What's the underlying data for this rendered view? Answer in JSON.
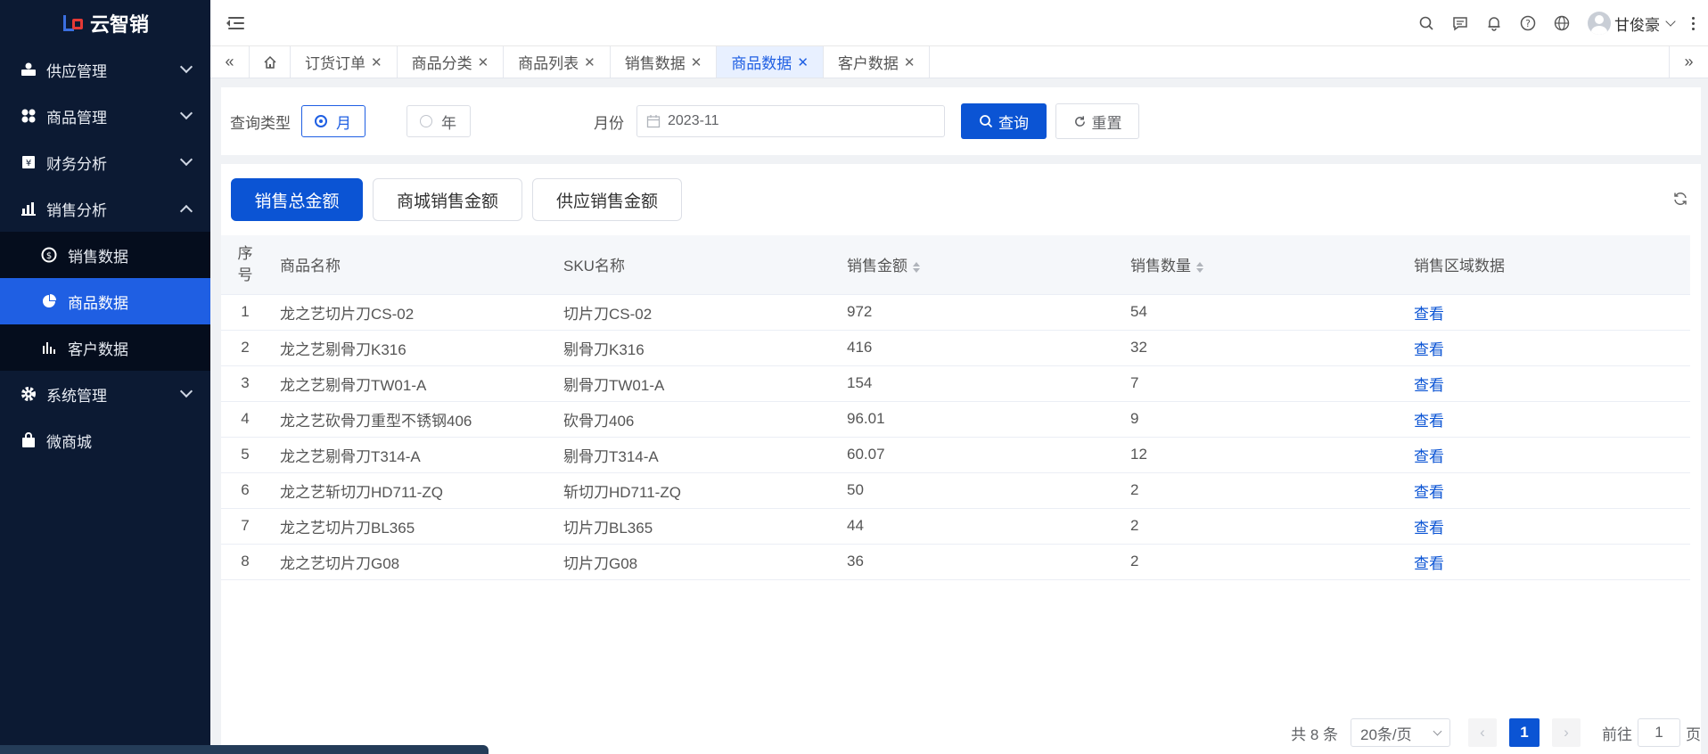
{
  "app": {
    "logo_text": "云智销"
  },
  "sidebar": {
    "items": [
      {
        "label": "供应管理",
        "icon": "supply-icon",
        "expanded": false
      },
      {
        "label": "商品管理",
        "icon": "goods-icon",
        "expanded": false
      },
      {
        "label": "财务分析",
        "icon": "finance-icon",
        "expanded": false
      },
      {
        "label": "销售分析",
        "icon": "sales-chart-icon",
        "expanded": true
      },
      {
        "label": "系统管理",
        "icon": "gear-icon",
        "expanded": false
      },
      {
        "label": "微商城",
        "icon": "shop-bag-icon"
      }
    ],
    "sub_items": [
      {
        "label": "销售数据",
        "icon": "dollar-circle-icon",
        "active": false
      },
      {
        "label": "商品数据",
        "icon": "pie-chart-icon",
        "active": true
      },
      {
        "label": "客户数据",
        "icon": "bar-chart-icon",
        "active": false
      }
    ]
  },
  "header": {
    "username": "甘俊豪"
  },
  "tabs": [
    {
      "label": "订货订单",
      "active": false
    },
    {
      "label": "商品分类",
      "active": false
    },
    {
      "label": "商品列表",
      "active": false
    },
    {
      "label": "销售数据",
      "active": false
    },
    {
      "label": "商品数据",
      "active": true
    },
    {
      "label": "客户数据",
      "active": false
    }
  ],
  "search": {
    "query_type_label": "查询类型",
    "radio_month": "月",
    "radio_year": "年",
    "month_label": "月份",
    "month_value": "2023-11",
    "query_button": "查询",
    "reset_button": "重置"
  },
  "segments": [
    "销售总金额",
    "商城销售金额",
    "供应销售金额"
  ],
  "table": {
    "headers": [
      "序号",
      "商品名称",
      "SKU名称",
      "销售金额",
      "销售数量",
      "销售区域数据"
    ],
    "rows": [
      [
        "1",
        "龙之艺切片刀CS-02",
        "切片刀CS-02",
        "972",
        "54",
        "查看"
      ],
      [
        "2",
        "龙之艺剔骨刀K316",
        "剔骨刀K316",
        "416",
        "32",
        "查看"
      ],
      [
        "3",
        "龙之艺剔骨刀TW01-A",
        "剔骨刀TW01-A",
        "154",
        "7",
        "查看"
      ],
      [
        "4",
        "龙之艺砍骨刀重型不锈钢406",
        "砍骨刀406",
        "96.01",
        "9",
        "查看"
      ],
      [
        "5",
        "龙之艺剔骨刀T314-A",
        "剔骨刀T314-A",
        "60.07",
        "12",
        "查看"
      ],
      [
        "6",
        "龙之艺斩切刀HD711-ZQ",
        "斩切刀HD711-ZQ",
        "50",
        "2",
        "查看"
      ],
      [
        "7",
        "龙之艺切片刀BL365",
        "切片刀BL365",
        "44",
        "2",
        "查看"
      ],
      [
        "8",
        "龙之艺切片刀G08",
        "切片刀G08",
        "36",
        "2",
        "查看"
      ]
    ]
  },
  "pagination": {
    "total_text": "共 8 条",
    "page_size": "20条/页",
    "current_page": "1",
    "goto_label": "前往",
    "goto_value": "1",
    "page_unit": "页"
  },
  "colors": {
    "sidebar_bg": "#0c1a33",
    "accent": "#0b54d4",
    "active_menu": "#1f5fe3"
  }
}
